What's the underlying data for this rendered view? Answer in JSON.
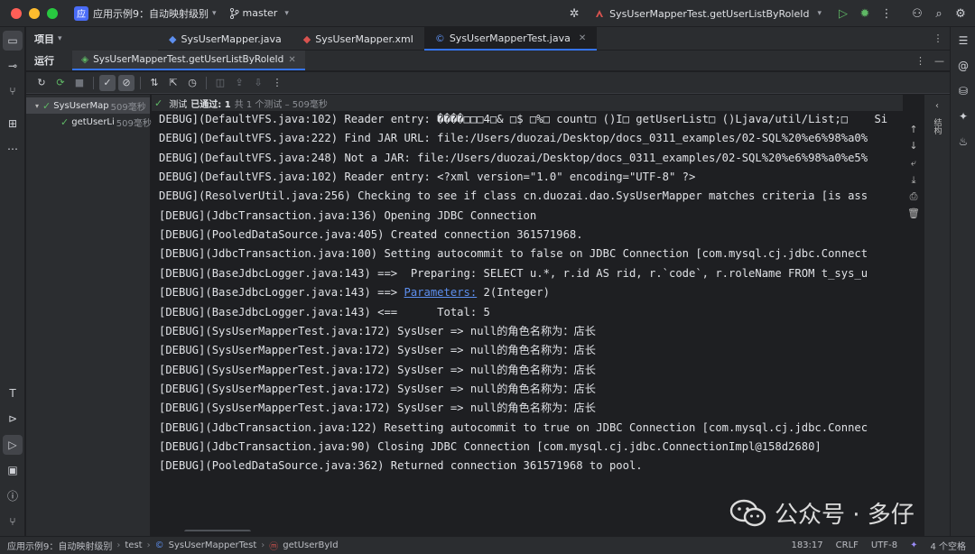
{
  "titlebar": {
    "project_badge": "应",
    "project_name": "应用示例9：自动映射级别",
    "branch": "master",
    "run_config": "SysUserMapperTest.getUserListByRoleId"
  },
  "project_panel": {
    "title": "项目"
  },
  "editor_tabs": [
    {
      "label": "SysUserMapper.java",
      "active": false
    },
    {
      "label": "SysUserMapper.xml",
      "active": false
    },
    {
      "label": "SysUserMapperTest.java",
      "active": true
    }
  ],
  "run_panel": {
    "title": "运行",
    "tab_label": "SysUserMapperTest.getUserListByRoleId"
  },
  "test_tree": [
    {
      "label": "SysUserMap",
      "duration": "509毫秒"
    },
    {
      "label": "getUserLi",
      "duration": "509毫秒"
    }
  ],
  "test_status": {
    "prefix": "测试",
    "passed": "已通过: 1",
    "detail": "共 1 个测试 – 509毫秒"
  },
  "console_lines": [
    "DEBUG](DefaultVFS.java:102) Reader entry: ����□□□4□& □$ □%□ count□ ()I□ getUserList□ ()Ljava/util/List;□    Si",
    "DEBUG](DefaultVFS.java:222) Find JAR URL: file:/Users/duozai/Desktop/docs_0311_examples/02-SQL%20%e6%98%a0%",
    "DEBUG](DefaultVFS.java:248) Not a JAR: file:/Users/duozai/Desktop/docs_0311_examples/02-SQL%20%e6%98%a0%e5%",
    "DEBUG](DefaultVFS.java:102) Reader entry: <?xml version=\"1.0\" encoding=\"UTF-8\" ?>",
    "DEBUG](ResolverUtil.java:256) Checking to see if class cn.duozai.dao.SysUserMapper matches criteria [is ass",
    "[DEBUG](JdbcTransaction.java:136) Opening JDBC Connection",
    "[DEBUG](PooledDataSource.java:405) Created connection 361571968.",
    "[DEBUG](JdbcTransaction.java:100) Setting autocommit to false on JDBC Connection [com.mysql.cj.jdbc.Connect",
    "[DEBUG](BaseJdbcLogger.java:143) ==>  Preparing: SELECT u.*, r.id AS rid, r.`code`, r.roleName FROM t_sys_u",
    "[DEBUG](BaseJdbcLogger.java:143) <==      Total: 5",
    "[DEBUG](SysUserMapperTest.java:172) SysUser => null的角色名称为：店长",
    "[DEBUG](SysUserMapperTest.java:172) SysUser => null的角色名称为：店长",
    "[DEBUG](SysUserMapperTest.java:172) SysUser => null的角色名称为：店长",
    "[DEBUG](SysUserMapperTest.java:172) SysUser => null的角色名称为：店长",
    "[DEBUG](SysUserMapperTest.java:172) SysUser => null的角色名称为：店长",
    "[DEBUG](JdbcTransaction.java:122) Resetting autocommit to true on JDBC Connection [com.mysql.cj.jdbc.Connec",
    "[DEBUG](JdbcTransaction.java:90) Closing JDBC Connection [com.mysql.cj.jdbc.ConnectionImpl@158d2680]",
    "[DEBUG](PooledDataSource.java:362) Returned connection 361571968 to pool."
  ],
  "param_line": {
    "prefix": "[DEBUG](BaseJdbcLogger.java:143) ==> ",
    "link": "Parameters:",
    "suffix": " 2(Integer)"
  },
  "side_label": "结构",
  "statusbar": {
    "crumbs": [
      "应用示例9：自动映射级别",
      "test",
      "SysUserMapperTest",
      "getUserById"
    ],
    "position": "183:17",
    "line_sep": "CRLF",
    "encoding": "UTF-8",
    "indent": "4 个空格"
  },
  "watermark": "公众号 · 多仔",
  "colors": {
    "accent": "#3574f0",
    "pass_green": "#5fb865",
    "link": "#5d8fef",
    "bg": "#1e1f22",
    "panel": "#2b2d30"
  }
}
